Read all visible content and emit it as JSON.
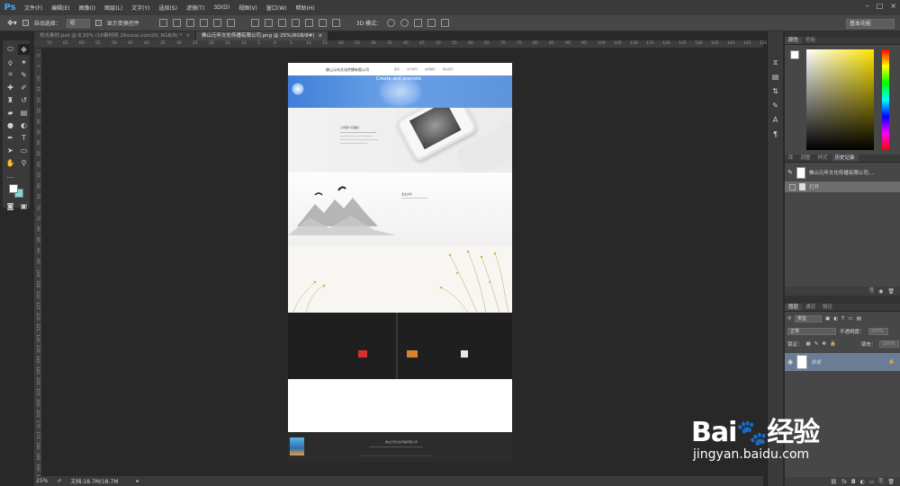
{
  "app": {
    "logo": "Ps"
  },
  "menu": [
    "文件(F)",
    "编辑(E)",
    "图像(I)",
    "图层(L)",
    "文字(Y)",
    "选择(S)",
    "滤镜(T)",
    "3D(D)",
    "视图(V)",
    "窗口(W)",
    "帮助(H)"
  ],
  "options": {
    "auto_select_label": "自动选择：",
    "auto_select_value": "组",
    "show_transform_label": "显示变换控件",
    "mode_3d_label": "3D 模式：",
    "workspace": "基本功能"
  },
  "tabs": [
    {
      "label": "炫光素材.psd @ 8.33% (16素材网 16sucai.com20, RGB/8) *",
      "close": "×"
    },
    {
      "label": "佛山元年文化传播有限公司.png @ 25%(RGB/8#)",
      "close": "×"
    }
  ],
  "ruler_top": [
    "70",
    "65",
    "60",
    "55",
    "50",
    "45",
    "40",
    "35",
    "30",
    "25",
    "20",
    "15",
    "10",
    "5",
    "0",
    "5",
    "10",
    "15",
    "20",
    "25",
    "30",
    "35",
    "40",
    "45",
    "50",
    "55",
    "60",
    "65",
    "70",
    "75",
    "80",
    "85",
    "90",
    "95",
    "100",
    "105",
    "110",
    "115",
    "120",
    "125",
    "130",
    "135",
    "140",
    "145",
    "150"
  ],
  "ruler_left": [
    "0",
    "5",
    "10",
    "15",
    "20",
    "25",
    "30",
    "35",
    "40",
    "45",
    "50",
    "55",
    "60",
    "65",
    "70",
    "75",
    "80",
    "85",
    "90",
    "95",
    "100",
    "105",
    "110",
    "115",
    "120",
    "125",
    "130",
    "135",
    "140",
    "145",
    "150",
    "155",
    "160",
    "165",
    "170",
    "175",
    "180",
    "185",
    "190",
    "195"
  ],
  "status": {
    "zoom": "25%",
    "doc": "文档:18.7M/18.7M"
  },
  "artboard": {
    "company": "佛山元年文化传播有限公司",
    "nav": [
      "首页",
      "关于我们",
      "案例展示",
      "联系我们"
    ],
    "banner_text": "Create and promote",
    "about_title": "公司简介及理念",
    "culture_title": "企业文化",
    "footer_text": "佛山元年文化传播有限公司"
  },
  "panels": {
    "color_tabs": [
      "颜色",
      "色板"
    ],
    "history_tabs": [
      "库",
      "调整",
      "样式",
      "历史记录"
    ],
    "history_items": [
      "佛山元年文化传播有限公司....",
      "打开"
    ],
    "layers_tabs": [
      "图层",
      "通道",
      "路径"
    ],
    "kind_label": "类型",
    "blend_mode": "正常",
    "opacity_label": "不透明度：",
    "opacity_value": "100%",
    "lock_label": "锁定：",
    "fill_label": "填充：",
    "fill_value": "100%",
    "layer_name": "背景"
  },
  "watermark": {
    "text": "Bai",
    "text2": "经验",
    "url": "jingyan.baidu.com"
  },
  "colors": {
    "accent": "#3fa6ff",
    "banner": "#5b93dd",
    "fg_swatch": "#ffffff",
    "bg_swatch": "#7fd6e0"
  }
}
